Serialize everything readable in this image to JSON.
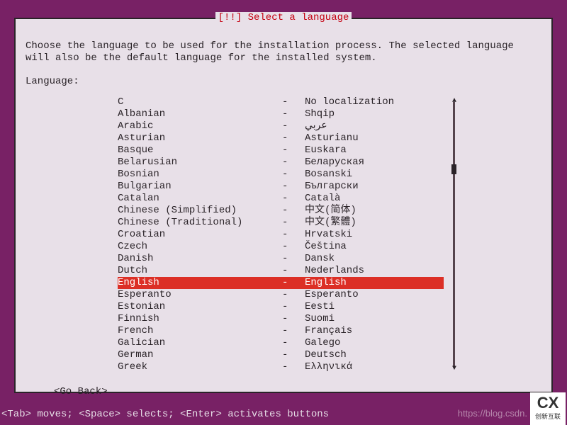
{
  "dialog": {
    "title": "[!!] Select a language",
    "instructions": "Choose the language to be used for the installation process. The selected language will also be the default language for the installed system.",
    "field_label": "Language:",
    "go_back": "<Go Back>"
  },
  "languages": [
    {
      "name": "C",
      "native": "No localization",
      "selected": false
    },
    {
      "name": "Albanian",
      "native": "Shqip",
      "selected": false
    },
    {
      "name": "Arabic",
      "native": "عربي",
      "selected": false
    },
    {
      "name": "Asturian",
      "native": "Asturianu",
      "selected": false
    },
    {
      "name": "Basque",
      "native": "Euskara",
      "selected": false
    },
    {
      "name": "Belarusian",
      "native": "Беларуская",
      "selected": false
    },
    {
      "name": "Bosnian",
      "native": "Bosanski",
      "selected": false
    },
    {
      "name": "Bulgarian",
      "native": "Български",
      "selected": false
    },
    {
      "name": "Catalan",
      "native": "Català",
      "selected": false
    },
    {
      "name": "Chinese (Simplified)",
      "native": "中文(简体)",
      "selected": false
    },
    {
      "name": "Chinese (Traditional)",
      "native": "中文(繁體)",
      "selected": false
    },
    {
      "name": "Croatian",
      "native": "Hrvatski",
      "selected": false
    },
    {
      "name": "Czech",
      "native": "Čeština",
      "selected": false
    },
    {
      "name": "Danish",
      "native": "Dansk",
      "selected": false
    },
    {
      "name": "Dutch",
      "native": "Nederlands",
      "selected": false
    },
    {
      "name": "English",
      "native": "English",
      "selected": true
    },
    {
      "name": "Esperanto",
      "native": "Esperanto",
      "selected": false
    },
    {
      "name": "Estonian",
      "native": "Eesti",
      "selected": false
    },
    {
      "name": "Finnish",
      "native": "Suomi",
      "selected": false
    },
    {
      "name": "French",
      "native": "Français",
      "selected": false
    },
    {
      "name": "Galician",
      "native": "Galego",
      "selected": false
    },
    {
      "name": "German",
      "native": "Deutsch",
      "selected": false
    },
    {
      "name": "Greek",
      "native": "Ελληνικά",
      "selected": false
    }
  ],
  "separator": "-",
  "bottombar": "<Tab> moves; <Space> selects; <Enter> activates buttons",
  "watermark": "https://blog.csdn.",
  "brand": {
    "mark": "CX",
    "text": "创新互联"
  }
}
